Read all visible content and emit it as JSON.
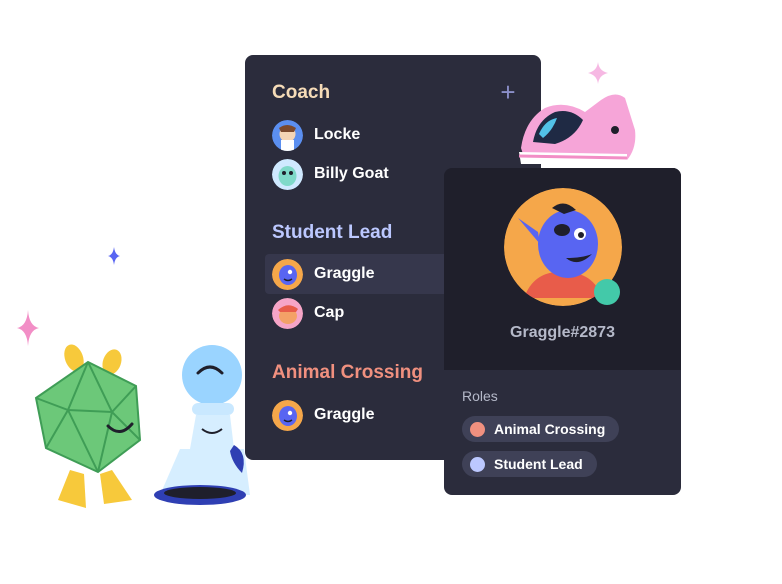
{
  "member_list": {
    "groups": [
      {
        "title": "Coach",
        "color": "#f6dcb8",
        "members": [
          {
            "name": "Locke",
            "avatar": "locke-avatar"
          },
          {
            "name": "Billy Goat",
            "avatar": "billy-goat-avatar"
          }
        ]
      },
      {
        "title": "Student Lead",
        "color": "#bcc8ff",
        "members": [
          {
            "name": "Graggle",
            "avatar": "graggle-avatar",
            "selected": true
          },
          {
            "name": "Cap",
            "avatar": "cap-avatar"
          }
        ]
      },
      {
        "title": "Animal Crossing",
        "color": "#f0907f",
        "members": [
          {
            "name": "Graggle",
            "avatar": "graggle-avatar"
          }
        ]
      }
    ],
    "add_icon": "plus-icon"
  },
  "profile_card": {
    "username": "Graggle#2873",
    "status_color": "#43c9a9",
    "roles_label": "Roles",
    "roles": [
      {
        "name": "Animal Crossing",
        "color": "#f0907f"
      },
      {
        "name": "Student Lead",
        "color": "#bcc8ff"
      }
    ]
  },
  "decorations": [
    "sneaker-illustration",
    "d20-dice-character",
    "chess-pawn-character",
    "sparkle-icon"
  ]
}
